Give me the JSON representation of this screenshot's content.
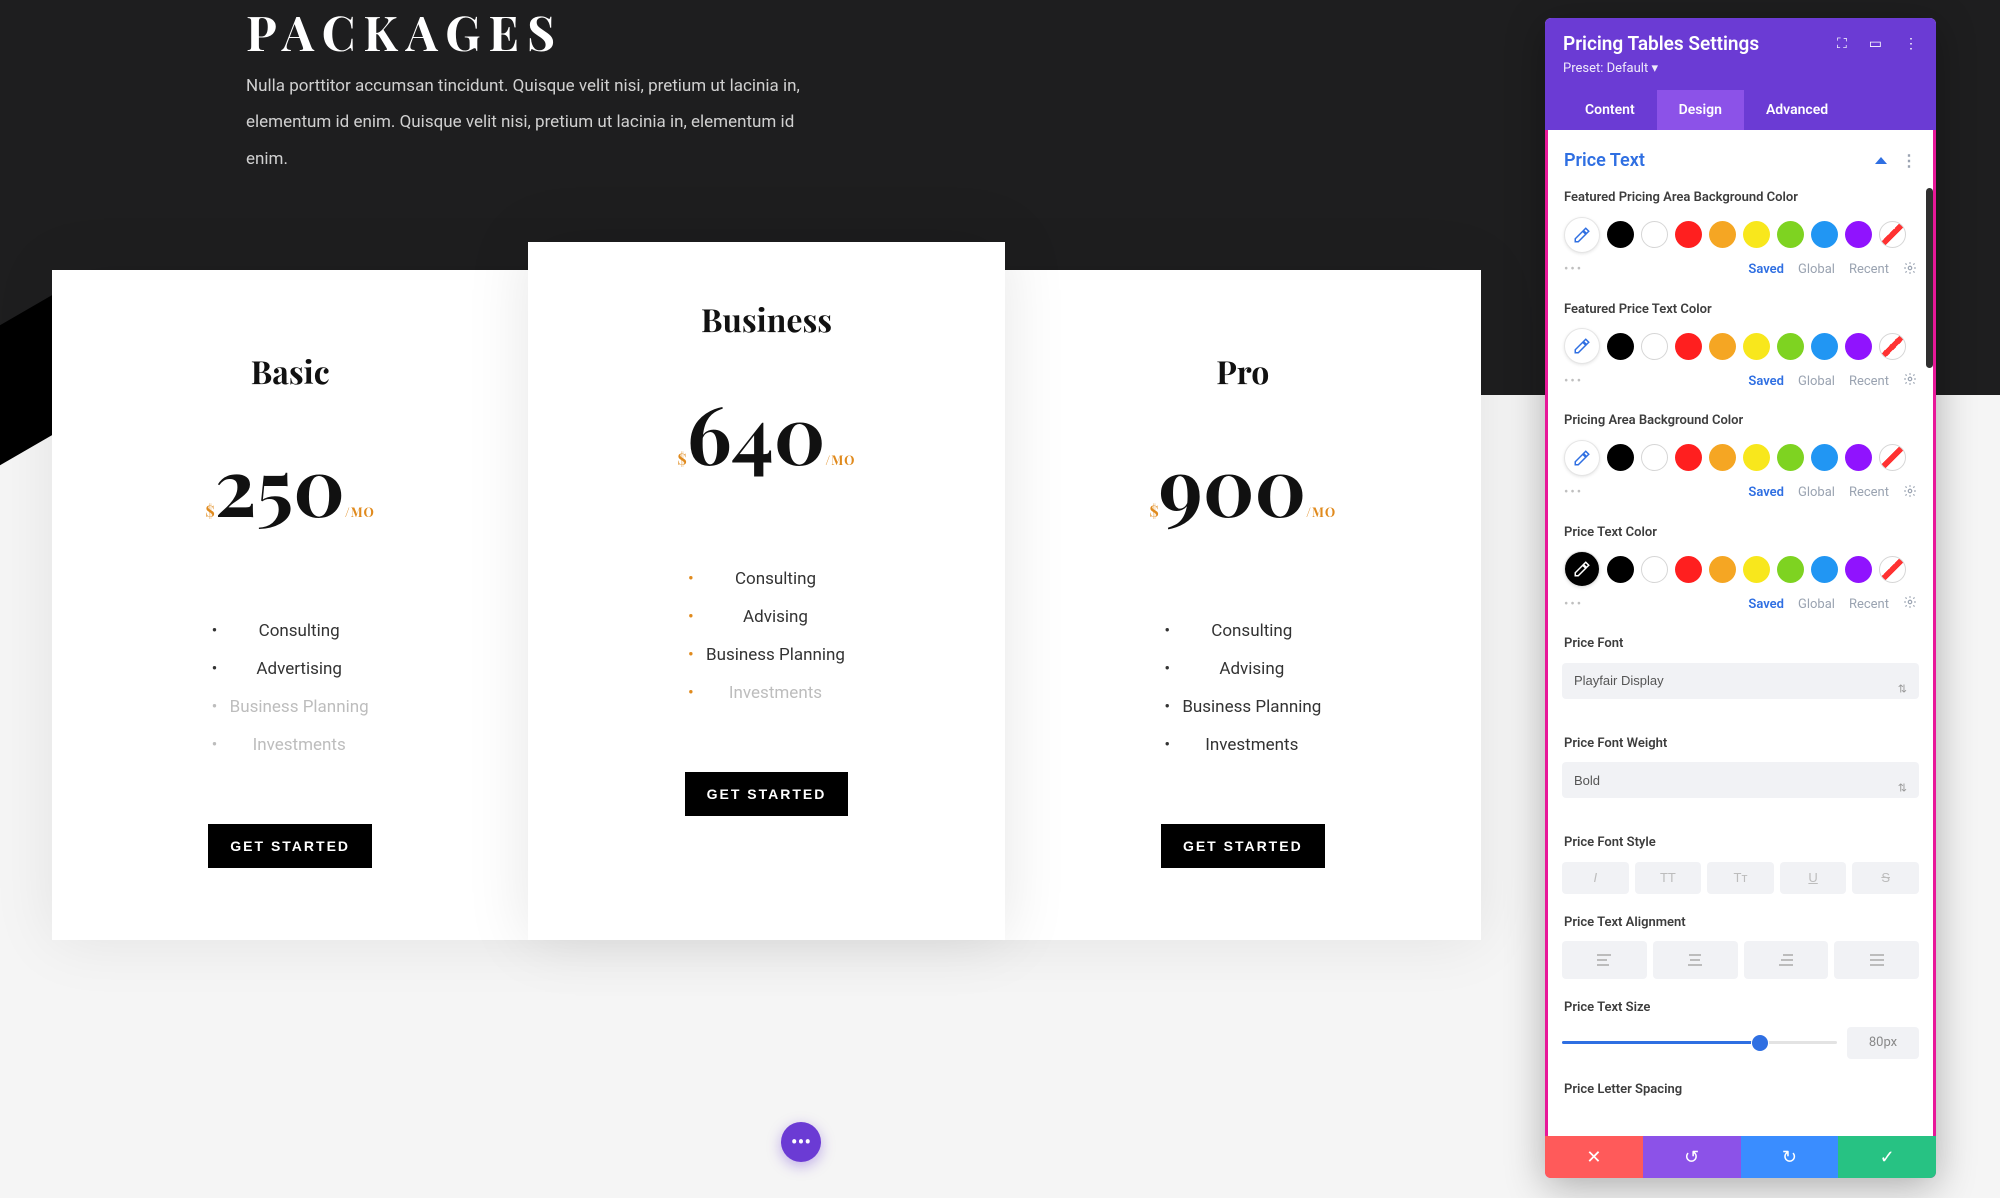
{
  "hero": {
    "title": "PACKAGES",
    "desc": "Nulla porttitor accumsan tincidunt. Quisque velit nisi, pretium ut lacinia in, elementum id enim. Quisque velit nisi, pretium ut lacinia in, elementum id enim."
  },
  "currency": "$",
  "period": "/MO",
  "cta": "GET STARTED",
  "plans": [
    {
      "name": "Basic",
      "price": "250",
      "featured": false,
      "features": [
        {
          "t": "Consulting",
          "on": true
        },
        {
          "t": "Advertising",
          "on": true
        },
        {
          "t": "Business Planning",
          "on": false
        },
        {
          "t": "Investments",
          "on": false
        }
      ]
    },
    {
      "name": "Business",
      "price": "640",
      "featured": true,
      "features": [
        {
          "t": "Consulting",
          "on": true
        },
        {
          "t": "Advising",
          "on": true
        },
        {
          "t": "Business Planning",
          "on": true
        },
        {
          "t": "Investments",
          "on": false
        }
      ]
    },
    {
      "name": "Pro",
      "price": "900",
      "featured": false,
      "features": [
        {
          "t": "Consulting",
          "on": true
        },
        {
          "t": "Advising",
          "on": true
        },
        {
          "t": "Business Planning",
          "on": true
        },
        {
          "t": "Investments",
          "on": true
        }
      ]
    }
  ],
  "panel": {
    "title": "Pricing Tables Settings",
    "preset": "Preset: Default",
    "tabs": [
      "Content",
      "Design",
      "Advanced"
    ],
    "active_tab": 1,
    "section": "Price Text",
    "swatch_meta": {
      "saved": "Saved",
      "global": "Global",
      "recent": "Recent"
    },
    "color_groups": [
      {
        "label": "Featured Pricing Area Background Color",
        "picker_dark": false
      },
      {
        "label": "Featured Price Text Color",
        "picker_dark": false
      },
      {
        "label": "Pricing Area Background Color",
        "picker_dark": false
      },
      {
        "label": "Price Text Color",
        "picker_dark": true
      }
    ],
    "palette": [
      "#000000",
      "border",
      "#ff1f1f",
      "#f5a623",
      "#f8e71c",
      "#7ed321",
      "#2196f3",
      "#9013fe",
      "slash"
    ],
    "selects": [
      {
        "label": "Price Font",
        "value": "Playfair Display"
      },
      {
        "label": "Price Font Weight",
        "value": "Bold"
      }
    ],
    "font_style_label": "Price Font Style",
    "font_styles": [
      "I",
      "TT",
      "Tᴛ",
      "U",
      "S"
    ],
    "align_label": "Price Text Alignment",
    "size_label": "Price Text Size",
    "size_value": "80px",
    "size_pct": 72,
    "letter_label": "Price Letter Spacing"
  }
}
